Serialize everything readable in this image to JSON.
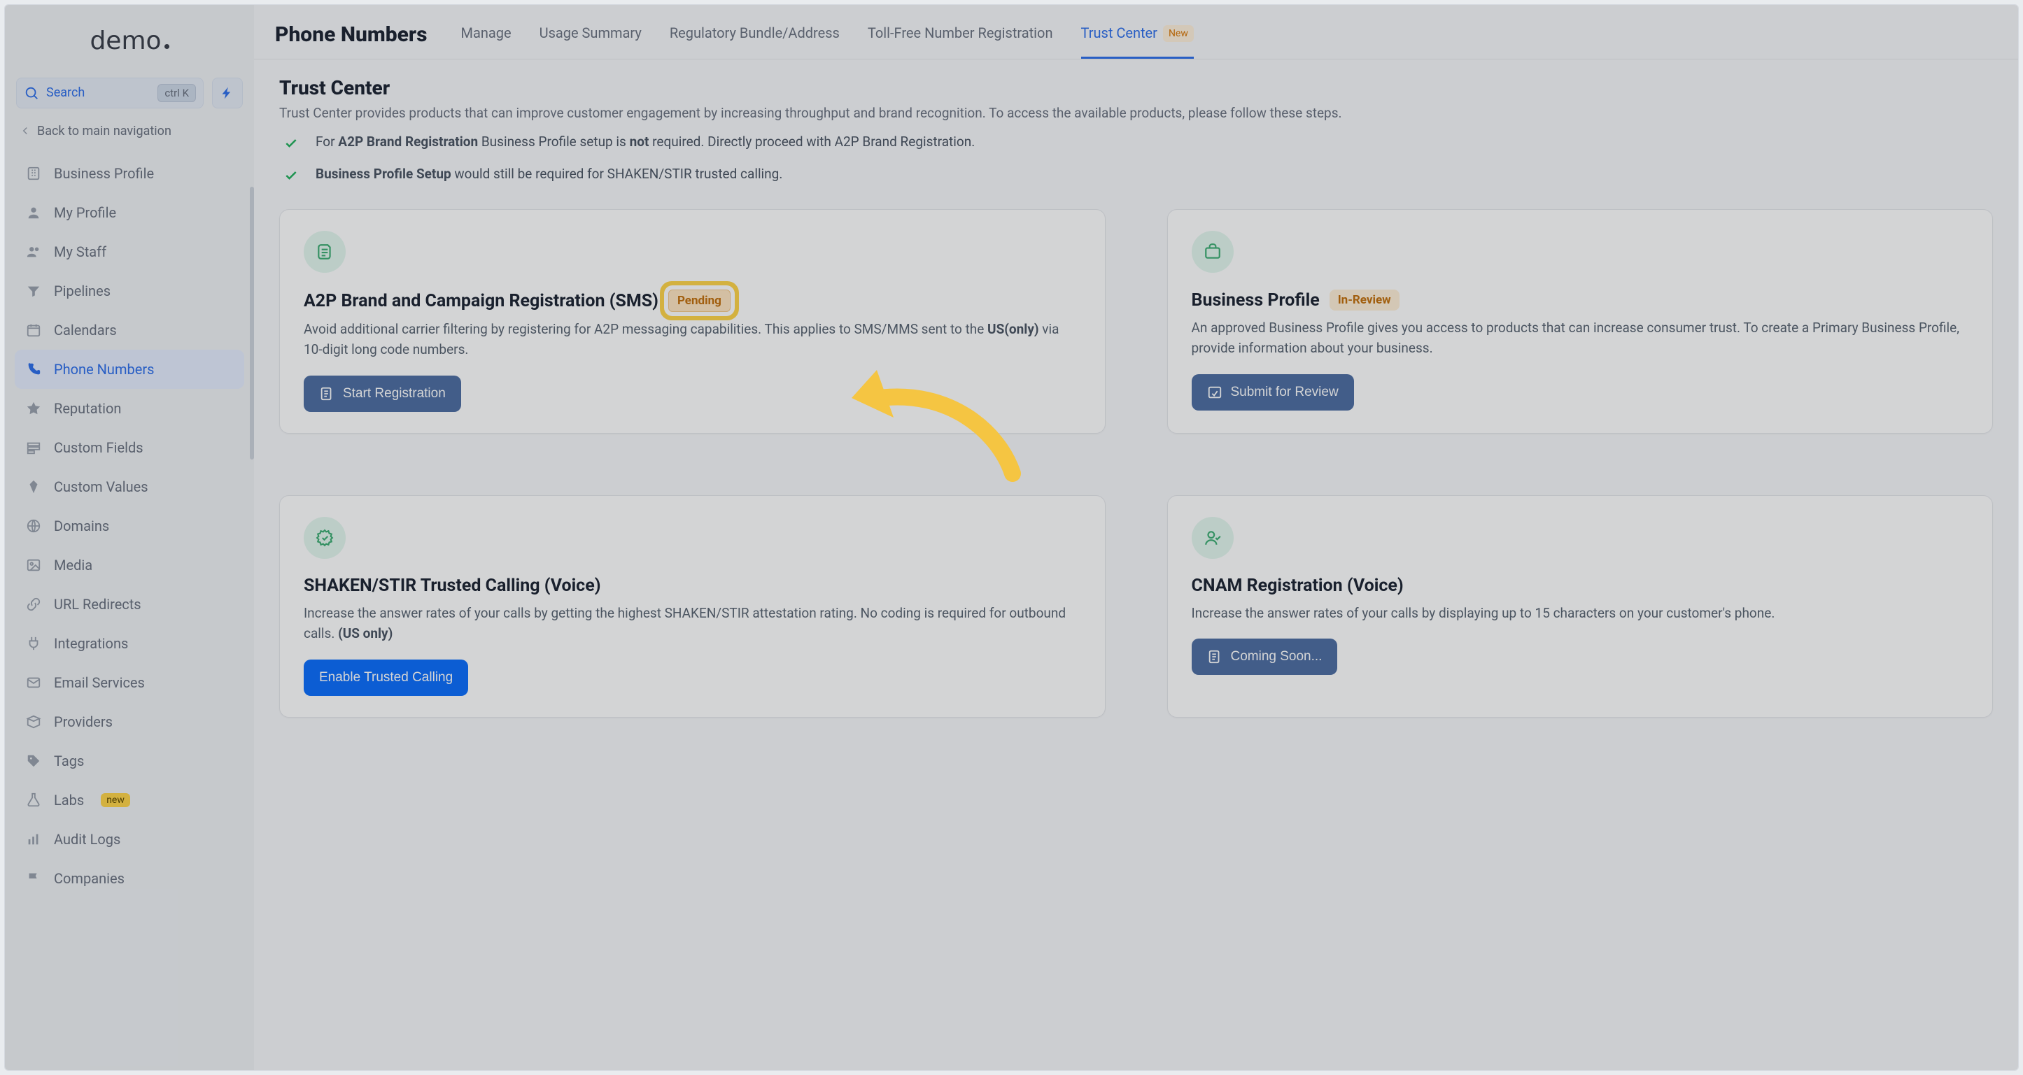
{
  "brand": {
    "name": "demo"
  },
  "search": {
    "label": "Search",
    "kbd": "ctrl K"
  },
  "back_label": "Back to main navigation",
  "nav": {
    "items": [
      {
        "label": "Business Profile",
        "icon": "building"
      },
      {
        "label": "My Profile",
        "icon": "user"
      },
      {
        "label": "My Staff",
        "icon": "users"
      },
      {
        "label": "Pipelines",
        "icon": "filter"
      },
      {
        "label": "Calendars",
        "icon": "calendar"
      },
      {
        "label": "Phone Numbers",
        "icon": "phone"
      },
      {
        "label": "Reputation",
        "icon": "star"
      },
      {
        "label": "Custom Fields",
        "icon": "fields"
      },
      {
        "label": "Custom Values",
        "icon": "diamond"
      },
      {
        "label": "Domains",
        "icon": "globe"
      },
      {
        "label": "Media",
        "icon": "image"
      },
      {
        "label": "URL Redirects",
        "icon": "link"
      },
      {
        "label": "Integrations",
        "icon": "plug"
      },
      {
        "label": "Email Services",
        "icon": "mail"
      },
      {
        "label": "Providers",
        "icon": "box"
      },
      {
        "label": "Tags",
        "icon": "tag"
      },
      {
        "label": "Labs",
        "icon": "flask",
        "badge": "new"
      },
      {
        "label": "Audit Logs",
        "icon": "bars"
      },
      {
        "label": "Companies",
        "icon": "flag"
      }
    ],
    "active_index": 5
  },
  "header": {
    "page_title": "Phone Numbers",
    "tabs": [
      {
        "label": "Manage"
      },
      {
        "label": "Usage Summary"
      },
      {
        "label": "Regulatory Bundle/Address"
      },
      {
        "label": "Toll-Free Number Registration"
      },
      {
        "label": "Trust Center",
        "active": true,
        "badge": "New"
      }
    ]
  },
  "trust_center": {
    "title": "Trust Center",
    "description": "Trust Center provides products that can improve customer engagement by increasing throughput and brand recognition. To access the available products, please follow these steps.",
    "checks": [
      {
        "pre": "For ",
        "bold1": "A2P Brand Registration",
        "mid": " Business Profile setup is ",
        "bold2": "not",
        "post": " required. Directly proceed with A2P Brand Registration."
      },
      {
        "bold1": "Business Profile Setup",
        "post": " would still be required for SHAKEN/STIR trusted calling."
      }
    ]
  },
  "cards": {
    "a2p": {
      "title": "A2P Brand and Campaign Registration (SMS)",
      "status": "Pending",
      "desc_pre": "Avoid additional carrier filtering by registering for A2P messaging capabilities. This applies to SMS/MMS sent to the ",
      "desc_bold": "US(only)",
      "desc_post": " via 10-digit long code numbers.",
      "button": "Start Registration"
    },
    "profile": {
      "title": "Business Profile",
      "status": "In-Review",
      "desc": "An approved Business Profile gives you access to products that can increase consumer trust. To create a Primary Business Profile, provide information about your business.",
      "button": "Submit for Review"
    },
    "shaken": {
      "title": "SHAKEN/STIR Trusted Calling (Voice)",
      "desc_pre": "Increase the answer rates of your calls by getting the highest SHAKEN/STIR attestation rating. No coding is required for outbound calls. ",
      "desc_bold": "(US only)",
      "button": "Enable Trusted Calling"
    },
    "cnam": {
      "title": "CNAM Registration (Voice)",
      "desc": "Increase the answer rates of your calls by displaying up to 15 characters on your customer's phone.",
      "button": "Coming Soon..."
    }
  }
}
